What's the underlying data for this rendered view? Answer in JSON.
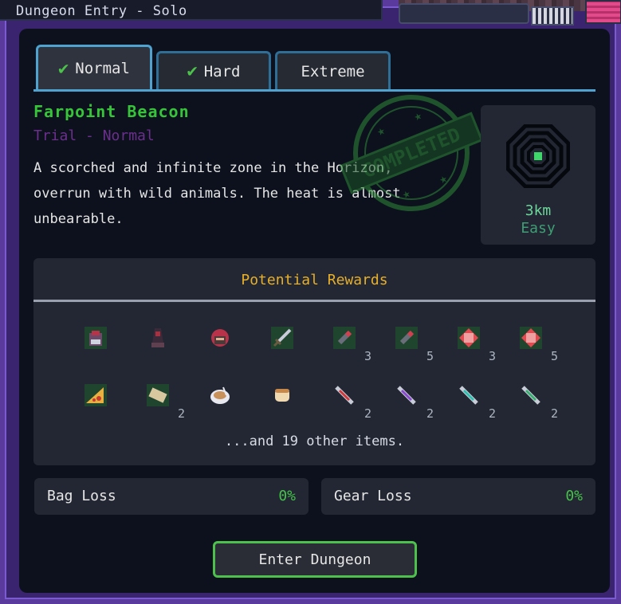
{
  "window": {
    "title": "Dungeon Entry - Solo"
  },
  "tabs": [
    {
      "label": "Normal",
      "completed": true,
      "active": true
    },
    {
      "label": "Hard",
      "completed": true,
      "active": false
    },
    {
      "label": "Extreme",
      "completed": false,
      "active": false
    }
  ],
  "dungeon": {
    "name": "Farpoint Beacon",
    "subtitle": "Trial - Normal",
    "description": "A scorched and infinite zone in the Horizon, overrun with wild animals. The heat is almost unbearable.",
    "stamp_text": "COMPLETED",
    "distance": "3km",
    "difficulty": "Easy"
  },
  "rewards": {
    "title": "Potential Rewards",
    "items": [
      {
        "icon": "chest-armor-icon",
        "qty": ""
      },
      {
        "icon": "robe-armor-icon",
        "qty": ""
      },
      {
        "icon": "helmet-icon",
        "qty": ""
      },
      {
        "icon": "sword-icon",
        "qty": ""
      },
      {
        "icon": "shell-ammo-icon",
        "qty": "3"
      },
      {
        "icon": "shell-ammo-icon",
        "qty": "5"
      },
      {
        "icon": "red-gem-icon",
        "qty": "3"
      },
      {
        "icon": "red-gem-icon",
        "qty": "5"
      },
      {
        "icon": "pizza-slice-icon",
        "qty": ""
      },
      {
        "icon": "scroll-icon",
        "qty": "2"
      },
      {
        "icon": "soup-bowl-icon",
        "qty": ""
      },
      {
        "icon": "bread-icon",
        "qty": ""
      },
      {
        "icon": "red-syringe-icon",
        "qty": "2"
      },
      {
        "icon": "purple-syringe-icon",
        "qty": "2"
      },
      {
        "icon": "teal-syringe-icon",
        "qty": "2"
      },
      {
        "icon": "green-syringe-icon",
        "qty": "2"
      }
    ],
    "more_text": "...and 19 other items."
  },
  "bag_loss": {
    "label": "Bag Loss",
    "value": "0%"
  },
  "gear_loss": {
    "label": "Gear Loss",
    "value": "0%"
  },
  "enter_button": {
    "label": "Enter Dungeon"
  },
  "colors": {
    "accent_green": "#4cc24c",
    "tab_border": "#4fa3d0",
    "reward_title": "#e8b02a",
    "frame_purple": "#5b3a9e"
  }
}
